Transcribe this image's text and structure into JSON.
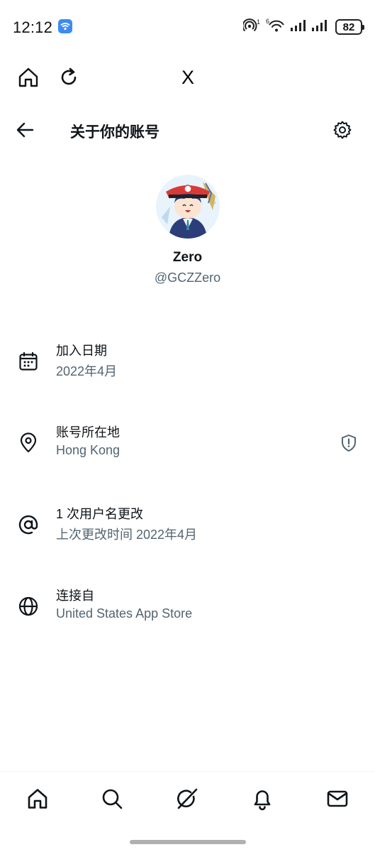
{
  "status_bar": {
    "time": "12:12",
    "battery": "82",
    "sim_index": "1",
    "network_label": "6"
  },
  "browser": {
    "logo_text": "X"
  },
  "header": {
    "title": "关于你的账号"
  },
  "profile": {
    "display_name": "Zero",
    "handle": "@GCZZero"
  },
  "info": [
    {
      "icon": "calendar-icon",
      "label": "加入日期",
      "value": "2022年4月"
    },
    {
      "icon": "location-pin-icon",
      "label": "账号所在地",
      "value": "Hong Kong",
      "badge_icon": "shield-icon"
    },
    {
      "icon": "at-sign-icon",
      "label": "1 次用户名更改",
      "value": "上次更改时间 2022年4月"
    },
    {
      "icon": "globe-icon",
      "label": "连接自",
      "value": "United States App Store"
    }
  ],
  "tabs": [
    {
      "name": "home",
      "icon": "home-icon"
    },
    {
      "name": "search",
      "icon": "search-icon"
    },
    {
      "name": "grok",
      "icon": "grok-icon"
    },
    {
      "name": "notifications",
      "icon": "bell-icon"
    },
    {
      "name": "messages",
      "icon": "mail-icon"
    }
  ],
  "colors": {
    "primary_text": "#0f1419",
    "secondary_text": "#536471",
    "background": "#ffffff",
    "wifi_badge": "#3d8bf2"
  }
}
